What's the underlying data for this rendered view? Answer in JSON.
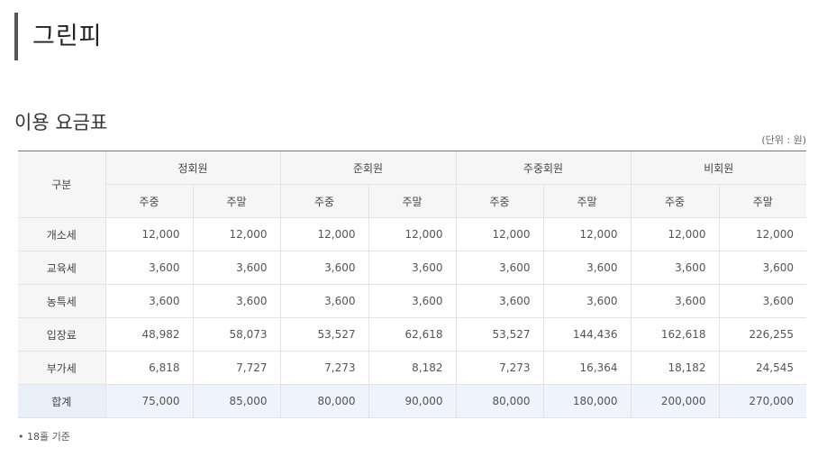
{
  "page": {
    "title": "그린피",
    "section_title": "이용 요금표",
    "unit": "(단위 : 원)",
    "note": "• 18홀 기준"
  },
  "table": {
    "corner_label": "구분",
    "groups": [
      "정회원",
      "준회원",
      "주중회원",
      "비회원"
    ],
    "subheaders": [
      "주중",
      "주말",
      "주중",
      "주말",
      "주중",
      "주말",
      "주중",
      "주말"
    ],
    "rows": [
      {
        "label": "개소세",
        "values": [
          "12,000",
          "12,000",
          "12,000",
          "12,000",
          "12,000",
          "12,000",
          "12,000",
          "12,000"
        ]
      },
      {
        "label": "교육세",
        "values": [
          "3,600",
          "3,600",
          "3,600",
          "3,600",
          "3,600",
          "3,600",
          "3,600",
          "3,600"
        ]
      },
      {
        "label": "농특세",
        "values": [
          "3,600",
          "3,600",
          "3,600",
          "3,600",
          "3,600",
          "3,600",
          "3,600",
          "3,600"
        ]
      },
      {
        "label": "입장료",
        "values": [
          "48,982",
          "58,073",
          "53,527",
          "62,618",
          "53,527",
          "144,436",
          "162,618",
          "226,255"
        ]
      },
      {
        "label": "부가세",
        "values": [
          "6,818",
          "7,727",
          "7,273",
          "8,182",
          "7,273",
          "16,364",
          "18,182",
          "24,545"
        ]
      },
      {
        "label": "합계",
        "values": [
          "75,000",
          "85,000",
          "80,000",
          "90,000",
          "80,000",
          "180,000",
          "200,000",
          "270,000"
        ]
      }
    ]
  }
}
